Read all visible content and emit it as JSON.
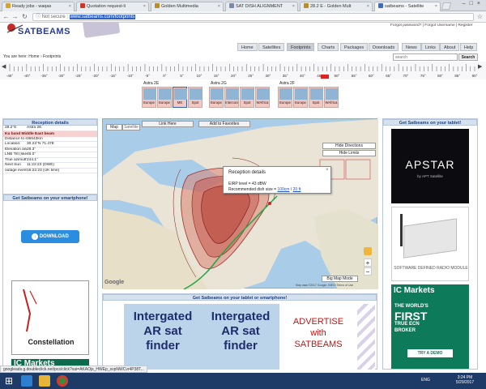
{
  "tabs": [
    {
      "label": "Ready jobs - waqas"
    },
    {
      "label": "Quotation request-li"
    },
    {
      "label": "Golden Multimedia"
    },
    {
      "label": "SAT DISH ALIGNMENT"
    },
    {
      "label": "28.2 E - Golden Mult"
    },
    {
      "label": "satbeams - Satellite"
    }
  ],
  "address": {
    "security": "Not secure",
    "url": "www.satbeams.com/footprints"
  },
  "header": {
    "logo": "SATBEAMS",
    "links": "Forgot password? | Forgot Username | Register",
    "nav": [
      "Home",
      "Satellites",
      "Footprints",
      "Charts",
      "Packages",
      "Downloads",
      "News",
      "Links",
      "About",
      "Help"
    ],
    "breadcrumb": "You are here: Home › Footprints",
    "search_placeholder": "search",
    "search_button": "Search"
  },
  "orbit": {
    "ticks": [
      "-45°",
      "-40°",
      "-35°",
      "-30°",
      "-25°",
      "-20°",
      "-15°",
      "-10°",
      "-5°",
      "0°",
      "5°",
      "10°",
      "15°",
      "20°",
      "25°",
      "30°",
      "35°",
      "40°",
      "45°",
      "50°",
      "55°",
      "60°",
      "65°",
      "70°",
      "75°",
      "80°",
      "85°",
      "90°"
    ],
    "highlight": "28.2°E"
  },
  "satellites": [
    {
      "name": "Astra 2E",
      "beams": [
        "Europe",
        "Europe",
        "ME",
        "Spot"
      ]
    },
    {
      "name": "Astra 2G",
      "beams": [
        "Europe",
        "Interconnect",
        "Spot",
        "WAfrica"
      ]
    },
    {
      "name": "Astra 2F",
      "beams": [
        "Europe",
        "Europe",
        "Spot",
        "WAfrica"
      ]
    }
  ],
  "reception": {
    "title": "Reception details",
    "top": [
      "28.2°E",
      "Astra 2E"
    ],
    "band": "Ku band Middle East beam",
    "rows": [
      {
        "k": "Distance to satellite:",
        "v": "36643km"
      },
      {
        "k": "Location:",
        "v": "30.23°N 71.47E"
      },
      {
        "k": "Elevation angle:",
        "v": "28.3°"
      },
      {
        "k": "LNB Tilt (skew):",
        "v": "46.0°"
      },
      {
        "k": "True azimuth:",
        "v": "244.1°"
      },
      {
        "k": "Next Sun",
        "v": "11:22:23 (DWE)"
      },
      {
        "k": "outage events:",
        "v": "16:22:23 (UK time)"
      }
    ]
  },
  "app_panel": {
    "title": "Get Satbeams on your smartphone!",
    "download": "DOWNLOAD",
    "constellation": "Constellation"
  },
  "map": {
    "buttons": [
      "Link Here",
      "Add to Favorites"
    ],
    "types": [
      "Map",
      "Satellite"
    ],
    "side_buttons": [
      "Hide Directions",
      "Hide Limits"
    ],
    "popup": {
      "title": "Reception details",
      "line1": "EIRP level = 43 dBW",
      "line2a": "Recommended dish size = ",
      "line2b": "100cm",
      "line2c": " / ",
      "line2d": "20 ft"
    },
    "bigmap": "Big Map Mode",
    "copyright": "Map data ©2017 Google, INEGI   Terms of Use",
    "google": "Google"
  },
  "right_panel": {
    "title": "Get Satbeams on your tablet!",
    "apstar_title": "APSTAR",
    "apstar_sub": "by APT Satellite",
    "radio": "SOFTWARE DEFINED RADIO MODULE",
    "ic_brand": "IC Markets",
    "ic_line1": "THE WORLD'S",
    "ic_line2": "FIRST",
    "ic_line3": "TRUE ECN",
    "ic_line4": "BROKER",
    "ic_cta": "TRY A DEMO"
  },
  "bottom_banner": {
    "title": "Get Satbeams on your tablet or smartphone!",
    "ad1": [
      "Intergated",
      "AR sat",
      "finder"
    ],
    "ad2": [
      "Intergated",
      "AR sat",
      "finder"
    ],
    "ad3": [
      "ADVERTISE",
      "with",
      "SATBEAMS"
    ]
  },
  "left_bottom": {
    "ic": "IC Markets"
  },
  "statusbar_url": "googleads.g.doubleclick.net/pcs/click?xai=AKAOjs_HWEp_svpNWCvr4P38T...",
  "taskbar": {
    "time": "3:24 PM",
    "date": "5/29/2017",
    "lang": "ENG"
  }
}
